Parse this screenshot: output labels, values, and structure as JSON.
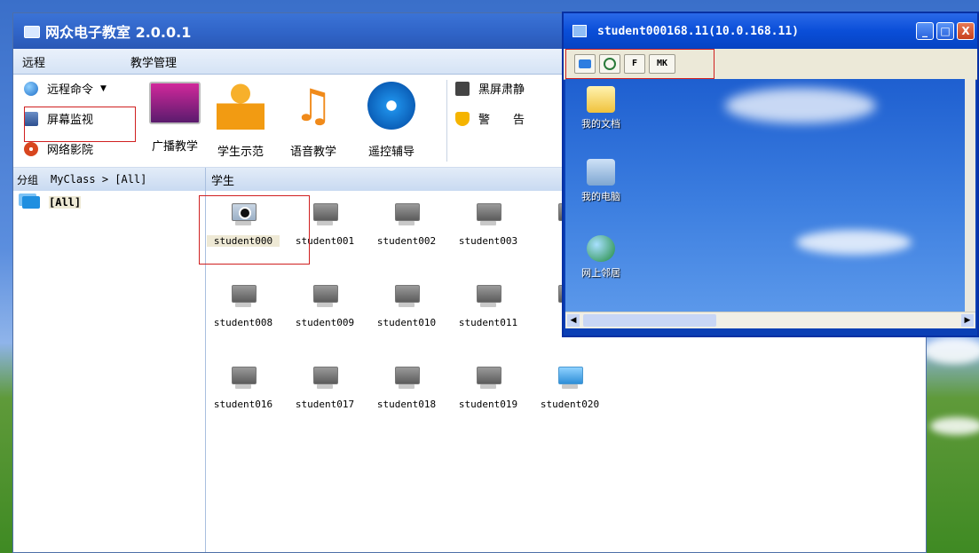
{
  "main_window": {
    "title": "网众电子教室 2.0.0.1",
    "menu": [
      "远程",
      "教学管理"
    ],
    "ribbon_small": {
      "remote_command": "远程命令",
      "screen_monitor": "屏幕监视",
      "network_cinema": "网络影院",
      "black_screen": "黑屏肃静",
      "warning": "警　　告"
    },
    "ribbon_big": [
      "广播教学",
      "学生示范",
      "语音教学",
      "遥控辅导"
    ],
    "group_header": "分组",
    "group_path": "MyClass > [All]",
    "student_header": "学生",
    "group_item": "[All]",
    "students": [
      {
        "name": "student000",
        "state": "camera"
      },
      {
        "name": "student001",
        "state": "off"
      },
      {
        "name": "student002",
        "state": "off"
      },
      {
        "name": "student003",
        "state": "off"
      },
      {
        "name": "stu",
        "state": "off"
      },
      {
        "name": "student008",
        "state": "off"
      },
      {
        "name": "student009",
        "state": "off"
      },
      {
        "name": "student010",
        "state": "off"
      },
      {
        "name": "student011",
        "state": "off"
      },
      {
        "name": "stu",
        "state": "off"
      },
      {
        "name": "student016",
        "state": "off"
      },
      {
        "name": "student017",
        "state": "off"
      },
      {
        "name": "student018",
        "state": "off"
      },
      {
        "name": "student019",
        "state": "off"
      },
      {
        "name": "student020",
        "state": "on"
      }
    ]
  },
  "remote_window": {
    "title": "student000168.11(10.0.168.11)",
    "toolbar": [
      "",
      "",
      "F",
      "MK"
    ],
    "desktop_icons": [
      "我的文档",
      "我的电脑",
      "网上邻居"
    ]
  },
  "colors": {
    "title_blue": "#2f63c6",
    "highlight_red": "#d02020",
    "header_blue": "#c9daf1"
  }
}
